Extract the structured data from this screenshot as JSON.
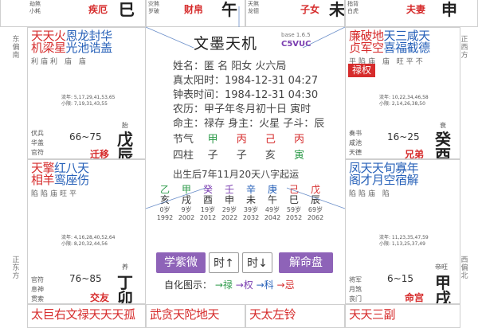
{
  "top_strip": {
    "left_text": "劫煞\n小耗",
    "left_palace": "疾厄",
    "left_branch": "巳",
    "mid_text": "灾煞\n岁破",
    "mid_palace": "财帛",
    "mid_branch": "午",
    "mid2_text": "天煞\n龙德",
    "mid2_palace": "子女",
    "mid2_branch": "未",
    "right_text": "指背\n白虎",
    "right_palace": "夫妻",
    "right_branch": "申"
  },
  "sides": {
    "left_top": "东偏南",
    "left_bottom": "正东方",
    "right_top": "正西方",
    "right_bottom": "西偏北"
  },
  "cells": {
    "chen": {
      "stars1": [
        [
          "天",
          "red"
        ],
        [
          "天",
          "red"
        ],
        [
          "火",
          "red"
        ],
        [
          "恩",
          "blue"
        ],
        [
          "龙",
          "blue"
        ],
        [
          "封",
          "blue"
        ],
        [
          "华",
          "blue"
        ]
      ],
      "stars2": [
        [
          "机",
          "red"
        ],
        [
          "梁",
          "red"
        ],
        [
          "星",
          "red"
        ],
        [
          "光",
          "blue"
        ],
        [
          "池",
          "blue"
        ],
        [
          "诰",
          "blue"
        ],
        [
          "盖",
          "blue"
        ]
      ],
      "levels": "利庙利  庙  庙",
      "ymeta": "流年: 5,17,29,41,53,65\n小限: 7,19,31,43,55",
      "left_meta": [
        "伏兵",
        "华盖",
        "官符"
      ],
      "range": "66~75",
      "palace": "迁移",
      "branch": "戊辰",
      "tag": "胎"
    },
    "you": {
      "stars1": [
        [
          "廉",
          "red"
        ],
        [
          "破",
          "red"
        ],
        [
          "地",
          "red"
        ],
        [
          "天",
          "blue"
        ],
        [
          "三",
          "blue"
        ],
        [
          "咸",
          "blue"
        ],
        [
          "天",
          "blue"
        ]
      ],
      "stars2": [
        [
          "贞",
          "red"
        ],
        [
          "军",
          "red"
        ],
        [
          "空",
          "red"
        ],
        [
          "喜",
          "blue"
        ],
        [
          "福",
          "blue"
        ],
        [
          "截",
          "blue"
        ],
        [
          "德",
          "blue"
        ]
      ],
      "levels": "平陷庙  庙  旺平不",
      "ymeta": "流年: 10,22,34,46,58\n小限: 2,14,26,38,50",
      "left_meta": [
        "奏书",
        "咸池",
        "天德"
      ],
      "range": "16~25",
      "palace": "兄弟",
      "branch": "癸酉",
      "tag": "衰",
      "hua": "禄权"
    },
    "mao": {
      "stars1": [
        [
          "天",
          "red"
        ],
        [
          "擎",
          "red"
        ],
        [
          "红",
          "blue"
        ],
        [
          "八",
          "blue"
        ],
        [
          "天",
          "blue"
        ]
      ],
      "stars2": [
        [
          "相",
          "red"
        ],
        [
          "羊",
          "red"
        ],
        [
          "鸾",
          "blue"
        ],
        [
          "座",
          "blue"
        ],
        [
          "伤",
          "blue"
        ]
      ],
      "levels": "陷陷庙旺平",
      "ymeta": "流年: 4,16,28,40,52,64\n小限: 8,20,32,44,56",
      "left_meta": [
        "官符",
        "息神",
        "贯索"
      ],
      "range": "76~85",
      "palace": "交友",
      "branch": "丁卯",
      "tag": "养"
    },
    "xu": {
      "stars1": [
        [
          "凤",
          "blue"
        ],
        [
          "天",
          "blue"
        ],
        [
          "天",
          "blue"
        ],
        [
          "旬",
          "blue"
        ],
        [
          "寡",
          "blue"
        ],
        [
          "年",
          "blue"
        ]
      ],
      "stars2": [
        [
          "阁",
          "blue"
        ],
        [
          "才",
          "blue"
        ],
        [
          "月",
          "blue"
        ],
        [
          "空",
          "blue"
        ],
        [
          "宿",
          "blue"
        ],
        [
          "解",
          "blue"
        ]
      ],
      "levels": "陷陷庙 陷",
      "ymeta": "流年: 11,23,35,47,59\n小限: 1,13,25,37,49",
      "left_meta": [
        "将军",
        "月煞",
        "丧门"
      ],
      "range": "6~15",
      "palace": "命宫",
      "branch": "甲戌",
      "tag": "帝旺"
    }
  },
  "center": {
    "title": "文墨天机",
    "version": "base 1.6.5",
    "code": "C5VUC",
    "lines": [
      "姓名：匿 名        阳女 火六局",
      "真太阳时：1984-12-31 04:27",
      "钟表时间：1984-12-31 04:30",
      "农历：甲子年冬月初十日 寅时",
      "命主：禄存 身主：火星 子斗：辰"
    ],
    "jieqi_label": "节气",
    "jieqi": [
      "甲",
      "丙",
      "己",
      "丙"
    ],
    "sizhu_label": "四柱",
    "sizhu": [
      "子",
      "子",
      "亥",
      "寅"
    ],
    "qiyun": "出生后7年11月20天八字起运",
    "dayun": [
      {
        "g": "乙",
        "z": "亥",
        "age": "0岁",
        "yr": "1992",
        "col": "green"
      },
      {
        "g": "甲",
        "z": "戌",
        "age": "9岁",
        "yr": "2002",
        "col": "green"
      },
      {
        "g": "癸",
        "z": "酉",
        "age": "19岁",
        "yr": "2012",
        "col": "purple"
      },
      {
        "g": "壬",
        "z": "申",
        "age": "29岁",
        "yr": "2022",
        "col": "purple"
      },
      {
        "g": "辛",
        "z": "未",
        "age": "39岁",
        "yr": "2032",
        "col": "blue"
      },
      {
        "g": "庚",
        "z": "午",
        "age": "49岁",
        "yr": "2042",
        "col": "blue"
      },
      {
        "g": "己",
        "z": "巳",
        "age": "59岁",
        "yr": "2052",
        "col": "red"
      },
      {
        "g": "戊",
        "z": "辰",
        "age": "69岁",
        "yr": "2062",
        "col": "red"
      }
    ],
    "buttons": {
      "xueziwei": "学紫微",
      "time_up": "时↑",
      "time_down": "时↓",
      "jiemingpan": "解命盘"
    },
    "legend_prefix": "自化图示：",
    "legend": [
      {
        "text": "→禄",
        "color": "green"
      },
      {
        "text": "→权",
        "color": "purple"
      },
      {
        "text": "→科",
        "color": "blue"
      },
      {
        "text": "→忌",
        "color": "red"
      }
    ]
  },
  "bottom_strip": {
    "left": "太巨右文禄天天天孤",
    "mid": "武贪天陀地天",
    "mid2": "天太左铃",
    "right": "天天三副"
  }
}
